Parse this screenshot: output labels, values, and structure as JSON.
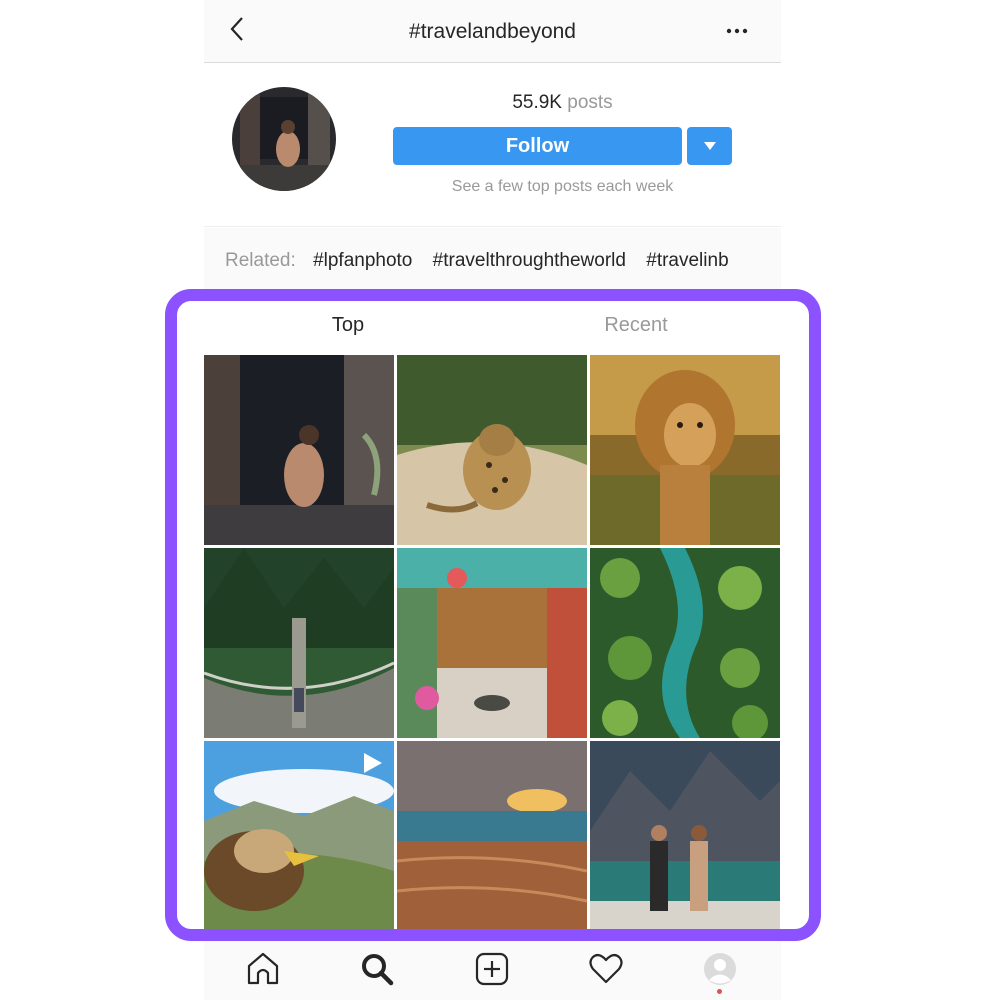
{
  "header": {
    "title": "#travelandbeyond",
    "back_icon": "chevron-left-icon",
    "more_icon": "more-horizontal-icon"
  },
  "profile": {
    "post_count": "55.9K",
    "post_label": "posts",
    "follow_label": "Follow",
    "dropdown_icon": "caret-down-icon",
    "subtext": "See a few top posts each week"
  },
  "related": {
    "label": "Related:",
    "tags": [
      "#lpfanphoto",
      "#travelthroughtheworld",
      "#travelinb"
    ]
  },
  "tabs": [
    {
      "label": "Top",
      "active": true
    },
    {
      "label": "Recent",
      "active": false
    }
  ],
  "grid": {
    "posts": [
      {
        "subject": "couple in wooden doorway",
        "video": false
      },
      {
        "subject": "leopard on sand",
        "video": false
      },
      {
        "subject": "lion in grass",
        "video": false
      },
      {
        "subject": "suspension bridge in forest",
        "video": false
      },
      {
        "subject": "colorful courtyard cafe",
        "video": false
      },
      {
        "subject": "aerial palm trees and river",
        "video": false
      },
      {
        "subject": "eagle over mountains",
        "video": true
      },
      {
        "subject": "beach at sunset",
        "video": false
      },
      {
        "subject": "couple by mountain lake",
        "video": false
      }
    ]
  },
  "bottom_nav": [
    {
      "name": "home",
      "icon": "home-icon"
    },
    {
      "name": "search",
      "icon": "search-icon",
      "active": true
    },
    {
      "name": "new-post",
      "icon": "plus-square-icon"
    },
    {
      "name": "activity",
      "icon": "heart-icon"
    },
    {
      "name": "profile",
      "icon": "profile-avatar-icon",
      "notification": true
    }
  ],
  "colors": {
    "accent_blue": "#3897f0",
    "highlight_purple": "#8c52ff",
    "notification_red": "#ed4956"
  }
}
